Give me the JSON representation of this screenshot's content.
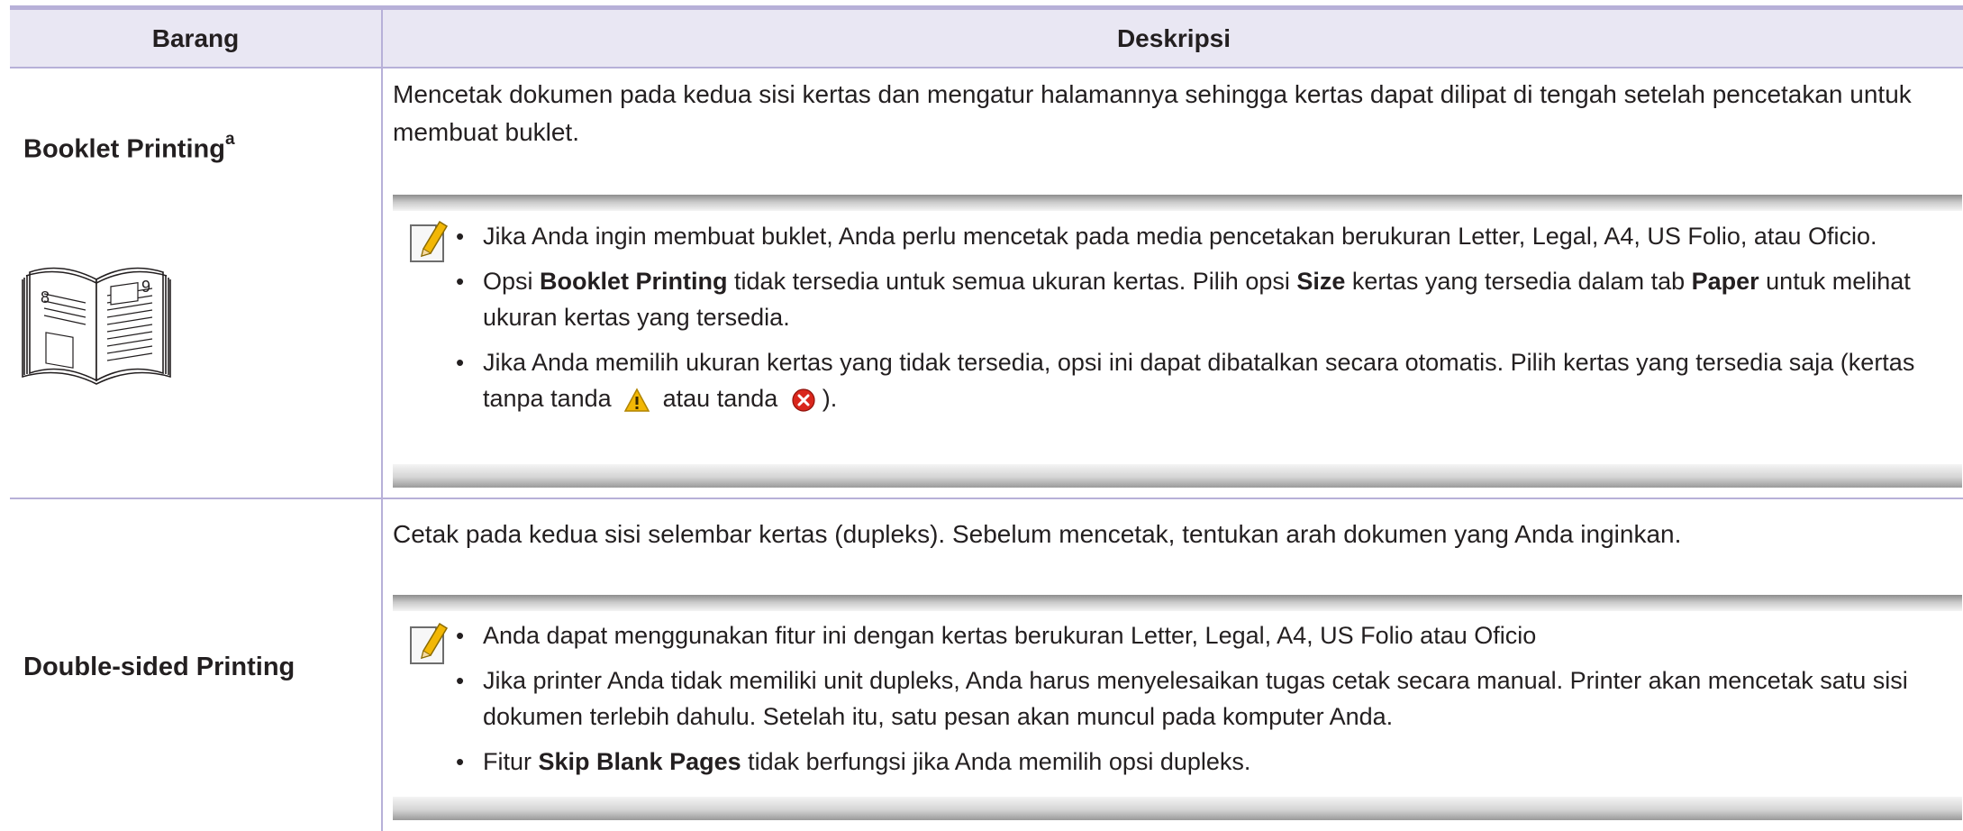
{
  "table": {
    "header": {
      "col_item": "Barang",
      "col_desc": "Deskripsi"
    },
    "rows": [
      {
        "item": "Booklet Printing",
        "footnote": "a",
        "description": "Mencetak dokumen pada kedua sisi kertas dan mengatur halamannya sehingga kertas dapat dilipat di tengah setelah pencetakan untuk membuat buklet.",
        "notes": [
          {
            "text": "Jika Anda ingin membuat buklet, Anda perlu mencetak pada media pencetakan berukuran Letter, Legal, A4, US Folio, atau Oficio."
          },
          {
            "t1": "Opsi ",
            "b1": "Booklet Printing",
            "t2": " tidak tersedia untuk semua ukuran kertas. Pilih opsi ",
            "b2": "Size",
            "t3": " kertas yang tersedia dalam tab ",
            "b3": "Paper",
            "t4": " untuk melihat ukuran kertas yang tersedia."
          },
          {
            "t1": "Jika Anda memilih ukuran kertas yang tidak tersedia, opsi ini dapat dibatalkan secara otomatis. Pilih kertas yang tersedia saja (kertas tanpa tanda ",
            "t2": " atau tanda ",
            "t3": ")."
          }
        ],
        "illustration": {
          "left_page_number": "8",
          "right_page_number": "9"
        }
      },
      {
        "item": "Double-sided Printing",
        "description": "Cetak pada kedua sisi selembar kertas (dupleks). Sebelum mencetak, tentukan arah dokumen yang Anda inginkan.",
        "notes": [
          {
            "text": "Anda dapat menggunakan fitur ini dengan kertas berukuran Letter, Legal, A4, US Folio atau Oficio"
          },
          {
            "text": "Jika printer Anda tidak memiliki unit dupleks, Anda harus menyelesaikan tugas cetak secara manual. Printer akan mencetak satu sisi dokumen terlebih dahulu. Setelah itu, satu pesan akan muncul pada komputer Anda."
          },
          {
            "t1": "Fitur ",
            "b1": "Skip Blank Pages",
            "t2": " tidak berfungsi jika Anda memilih opsi dupleks."
          }
        ]
      }
    ]
  },
  "icons": {
    "note": "note-pencil-icon",
    "warning": "warning-triangle-icon",
    "error": "error-x-circle-icon"
  },
  "colors": {
    "rule": "#b7b0d8",
    "header_bg": "#e9e7f3",
    "warning": "#f2b705",
    "error": "#d9261c"
  }
}
